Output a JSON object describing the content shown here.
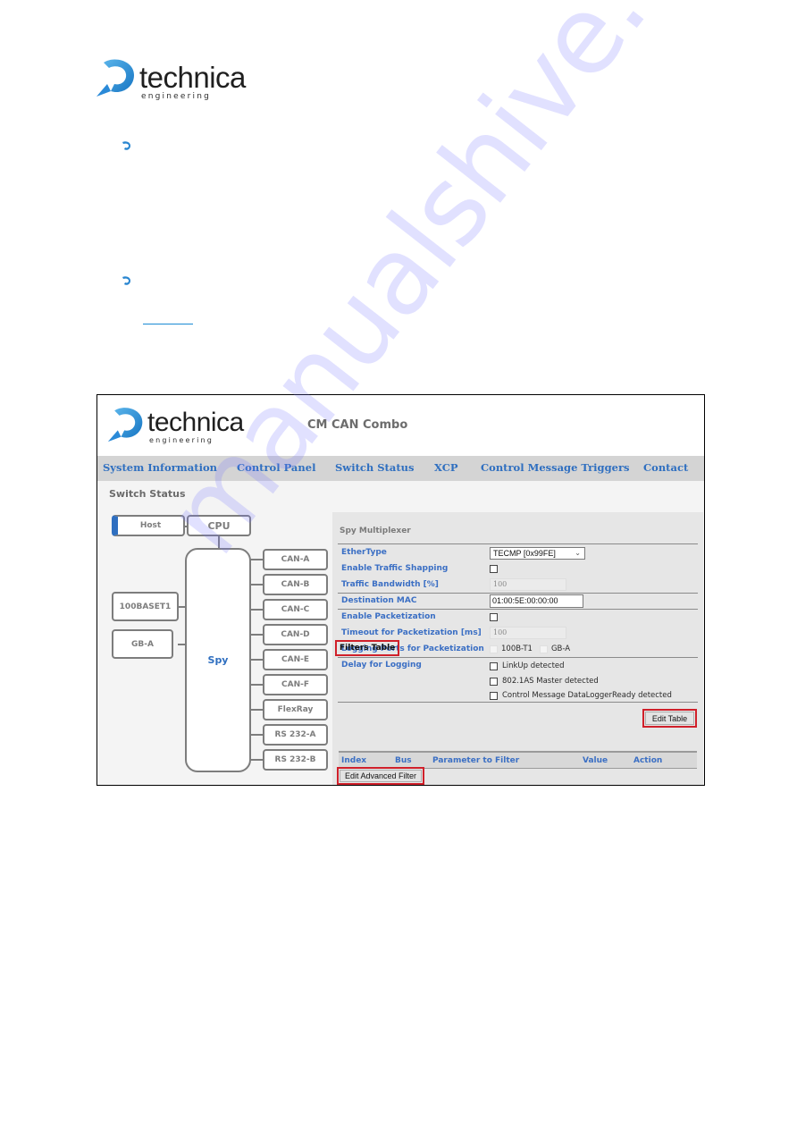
{
  "document": {
    "logo": {
      "brand": "technica",
      "sub": "engineering"
    },
    "bullets": [
      {
        "icon": "technica-swirl-bullet-icon"
      },
      {
        "icon": "technica-swirl-bullet-icon"
      }
    ],
    "link_underline": true
  },
  "app": {
    "logo": {
      "brand": "technica",
      "sub": "engineering"
    },
    "title": "CM CAN Combo",
    "nav": [
      {
        "label": "System Information"
      },
      {
        "label": "Control Panel"
      },
      {
        "label": "Switch Status"
      },
      {
        "label": "XCP"
      },
      {
        "label": "Control Message Triggers"
      },
      {
        "label": "Contact"
      }
    ],
    "section_title": "Switch Status",
    "diagram": {
      "host": "Host",
      "cpu": "CPU",
      "spy": "Spy",
      "left_ports": [
        "100BASET1",
        "GB-A"
      ],
      "right_ports": [
        "CAN-A",
        "CAN-B",
        "CAN-C",
        "CAN-D",
        "CAN-E",
        "CAN-F",
        "FlexRay",
        "RS 232-A",
        "RS 232-B"
      ]
    },
    "spy_multiplexer": {
      "title": "Spy Multiplexer",
      "ethertype": {
        "label": "EtherType",
        "value": "TECMP [0x99FE]"
      },
      "traffic_shaping": {
        "label": "Enable Traffic Shapping",
        "checked": false
      },
      "traffic_bandwidth": {
        "label": "Traffic Bandwidth [%]",
        "value": "100"
      },
      "destination_mac": {
        "label": "Destination MAC",
        "value": "01:00:5E:00:00:00"
      },
      "packetization": {
        "label": "Enable Packetization",
        "checked": false
      },
      "timeout": {
        "label": "Timeout for Packetization [ms]",
        "value": "100"
      },
      "logging_ports": {
        "label": "Logging Ports for Packetization",
        "options": [
          "100B-T1",
          "GB-A"
        ]
      },
      "delay_logging": {
        "label": "Delay for Logging",
        "options": [
          "LinkUp detected",
          "802.1AS Master detected",
          "Control Message DataLoggerReady detected"
        ]
      },
      "edit_table_button": "Edit Table"
    },
    "filters_table": {
      "title": "Filters Table",
      "columns": [
        "Index",
        "Bus",
        "Parameter to Filter",
        "Value",
        "Action"
      ],
      "rows": [],
      "edit_advanced_button": "Edit Advanced Filter"
    },
    "highlight_color": "#d0202a",
    "accent_color": "#2f6fc0"
  },
  "watermark": "manualshive.com"
}
